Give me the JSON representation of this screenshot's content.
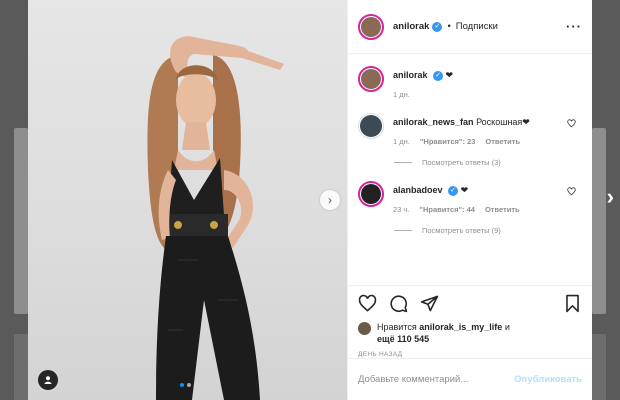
{
  "post": {
    "author": "anilorak",
    "header_separator": "•",
    "follow_label": "Подписки",
    "caption_emoji": "❤",
    "caption_time": "1 дн."
  },
  "comments": [
    {
      "username": "anilorak_news_fan",
      "text": "Роскошная❤",
      "time": "1 дн.",
      "likes": "\"Нравится\": 23",
      "reply_label": "Ответить",
      "view_replies": "Посмотреть ответы (3)",
      "verified": false
    },
    {
      "username": "alanbadoev",
      "text": "❤",
      "time": "23 ч.",
      "likes": "\"Нравится\": 44",
      "reply_label": "Ответить",
      "view_replies": "Посмотреть ответы (9)",
      "verified": true
    }
  ],
  "likes_line": {
    "prefix": "Нравится",
    "user": "anilorak_is_my_life",
    "conj": "и",
    "others": "ещё 110 545"
  },
  "time_ago": "ДЕНЬ НАЗАД",
  "add_comment": {
    "placeholder": "Добавьте комментарий...",
    "publish_label": "Опубликовать"
  },
  "carousel": {
    "current": 1,
    "total": 2
  },
  "colors": {
    "accent": "#0095f6",
    "verified": "#3897f0",
    "story_ring": "#d6249f",
    "publish_disabled": "#b2dffc"
  },
  "icons": [
    "heart-icon",
    "comment-icon",
    "share-icon",
    "bookmark-icon",
    "more-icon",
    "next-arrow-icon",
    "tag-user-icon",
    "verified-icon"
  ]
}
